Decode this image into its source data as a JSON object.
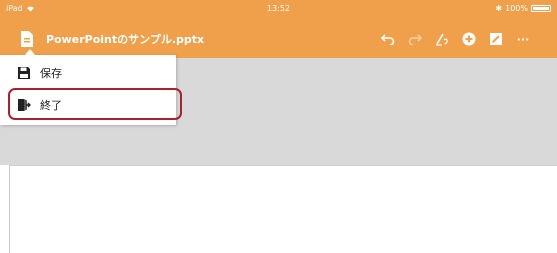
{
  "status_bar": {
    "device": "iPad",
    "time": "13:52",
    "battery": "100%"
  },
  "toolbar": {
    "title": "PowerPointのサンプル.pptx",
    "icons": [
      "document-icon",
      "undo-icon",
      "redo-icon",
      "pen-icon",
      "add-icon",
      "edit-icon",
      "more-icon"
    ],
    "more_label": "···"
  },
  "menu": {
    "items": [
      {
        "label": "保存",
        "icon": "save-icon"
      },
      {
        "label": "終了",
        "icon": "exit-icon",
        "highlighted": true
      }
    ]
  },
  "colors": {
    "accent": "#f0a04b",
    "canvas": "#d9d9d9",
    "highlight": "#a5222f"
  }
}
